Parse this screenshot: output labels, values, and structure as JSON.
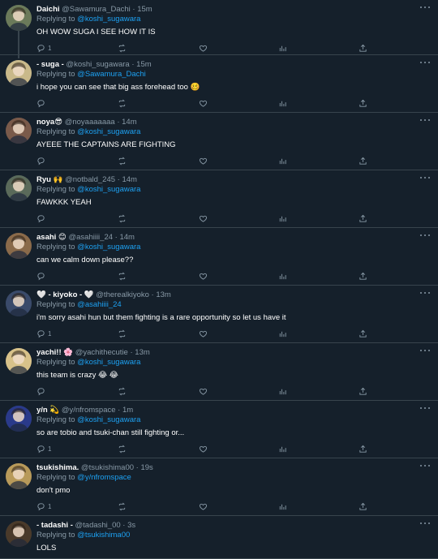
{
  "tweets": [
    {
      "name": "Daichi",
      "handle": "@Sawamura_Dachi",
      "dot": "·",
      "time": "15m",
      "reply_prefix": "Replying to",
      "reply_to": "@koshi_sugawara",
      "text": "OH WOW SUGA I SEE HOW IT IS",
      "reply_count": "1",
      "avatar_color": "#6b7a5a"
    },
    {
      "name": "- suga -",
      "handle": "@koshi_sugawara",
      "dot": "·",
      "time": "15m",
      "reply_prefix": "Replying to",
      "reply_to": "@Sawamura_Dachi",
      "text": "i hope you can see that big ass forehead too 🥴",
      "reply_count": "",
      "avatar_color": "#c9b98a"
    },
    {
      "name": "noya😎",
      "handle": "@noyaaaaaaa",
      "dot": "·",
      "time": "14m",
      "reply_prefix": "Replying to",
      "reply_to": "@koshi_sugawara",
      "text": "AYEEE THE CAPTAINS ARE FIGHTING",
      "reply_count": "",
      "avatar_color": "#7a5a4a"
    },
    {
      "name": "Ryu 🙌",
      "handle": "@notbald_245",
      "dot": "·",
      "time": "14m",
      "reply_prefix": "Replying to",
      "reply_to": "@koshi_sugawara",
      "text": "FAWKKK YEAH",
      "reply_count": "",
      "avatar_color": "#5a6a5a"
    },
    {
      "name": "asahi 😊",
      "handle": "@asahiiii_24",
      "dot": "·",
      "time": "14m",
      "reply_prefix": "Replying to",
      "reply_to": "@koshi_sugawara",
      "text": "can we calm down please??",
      "reply_count": "",
      "avatar_color": "#8a6a4a"
    },
    {
      "name": "🤍 - kiyoko - 🤍",
      "handle": "@therealkiyoko",
      "dot": "·",
      "time": "13m",
      "reply_prefix": "Replying to",
      "reply_to": "@asahiiii_24",
      "text": "i'm sorry asahi hun but them fighting is a rare opportunity so let us have it",
      "reply_count": "1",
      "avatar_color": "#3a4a6a"
    },
    {
      "name": "yachi!! 🌸",
      "handle": "@yachithecutie",
      "dot": "·",
      "time": "13m",
      "reply_prefix": "Replying to",
      "reply_to": "@koshi_sugawara",
      "text": "this team is crazy 😂 😂",
      "reply_count": "",
      "avatar_color": "#d8c28a"
    },
    {
      "name": "y/n 💫",
      "handle": "@y/nfromspace",
      "dot": "·",
      "time": "1m",
      "reply_prefix": "Replying to",
      "reply_to": "@koshi_sugawara",
      "text": "so are tobio and tsuki-chan still fighting or...",
      "reply_count": "1",
      "avatar_color": "#2a3a8a"
    },
    {
      "name": "tsukishima.",
      "handle": "@tsukishima00",
      "dot": "·",
      "time": "19s",
      "reply_prefix": "Replying to",
      "reply_to": "@y/nfromspace",
      "text": "don't pmo",
      "reply_count": "1",
      "avatar_color": "#b89a5a"
    },
    {
      "name": "- tadashi -",
      "handle": "@tadashi_00",
      "dot": "·",
      "time": "3s",
      "reply_prefix": "Replying to",
      "reply_to": "@tsukishima00",
      "text": "LOLS",
      "reply_count": "",
      "avatar_color": "#4a3a2a"
    }
  ],
  "icons": {
    "reply": "reply-icon",
    "retweet": "retweet-icon",
    "like": "heart-icon",
    "stats": "analytics-icon",
    "share": "share-icon",
    "more": "more-icon"
  }
}
